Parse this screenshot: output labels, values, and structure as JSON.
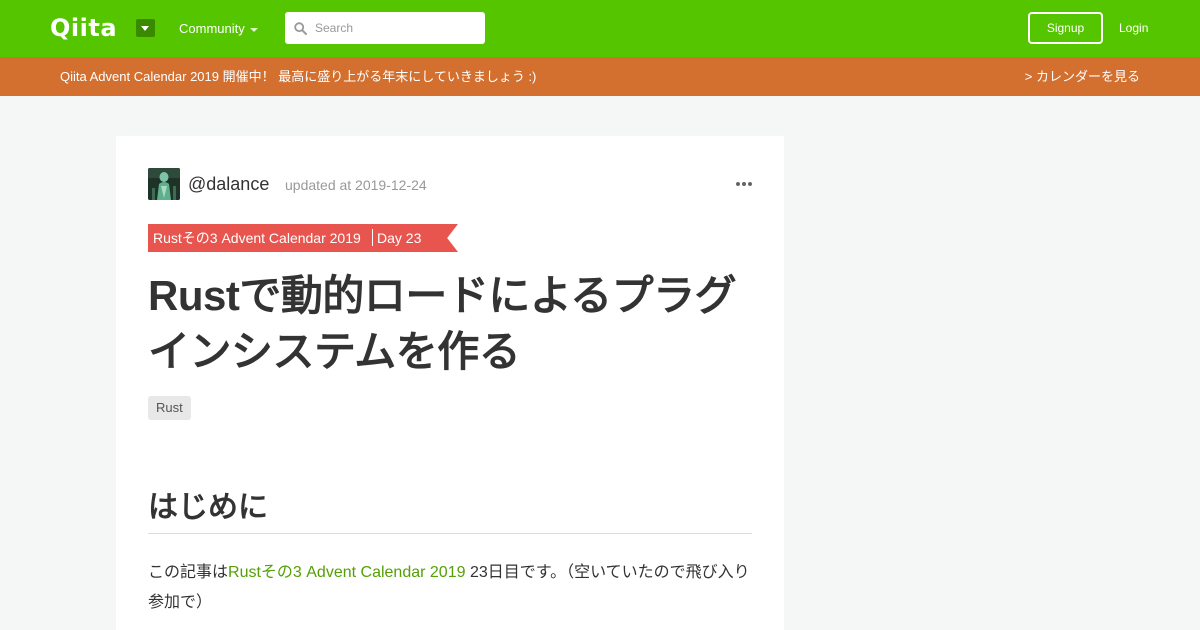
{
  "colors": {
    "brand": "#55c500",
    "banner": "#d37030",
    "ribbon": "#e8554e",
    "link": "#55a005"
  },
  "header": {
    "logo": "Qiita",
    "community": "Community",
    "search_placeholder": "Search",
    "signup": "Signup",
    "login": "Login"
  },
  "banner": {
    "text": "Qiita Advent Calendar 2019 開催中！ 最高に盛り上がる年末にしていきましょう :)",
    "link": "> カレンダーを見る"
  },
  "article": {
    "author": "@dalance",
    "updated": "updated at 2019-12-24",
    "advent": {
      "calendar": "Rustその3 Advent Calendar 2019",
      "day": "Day 23"
    },
    "title": "Rustで動的ロードによるプラグインシステムを作る",
    "tags": [
      "Rust"
    ],
    "section_heading": "はじめに",
    "intro": {
      "before": "この記事は",
      "link": "Rustその3 Advent Calendar 2019",
      "after": " 23日目です。（空いていたので飛び入り参加で）"
    }
  },
  "icons": {
    "search": "search-icon",
    "more": "more-options-icon",
    "caret": "chevron-down-icon"
  }
}
